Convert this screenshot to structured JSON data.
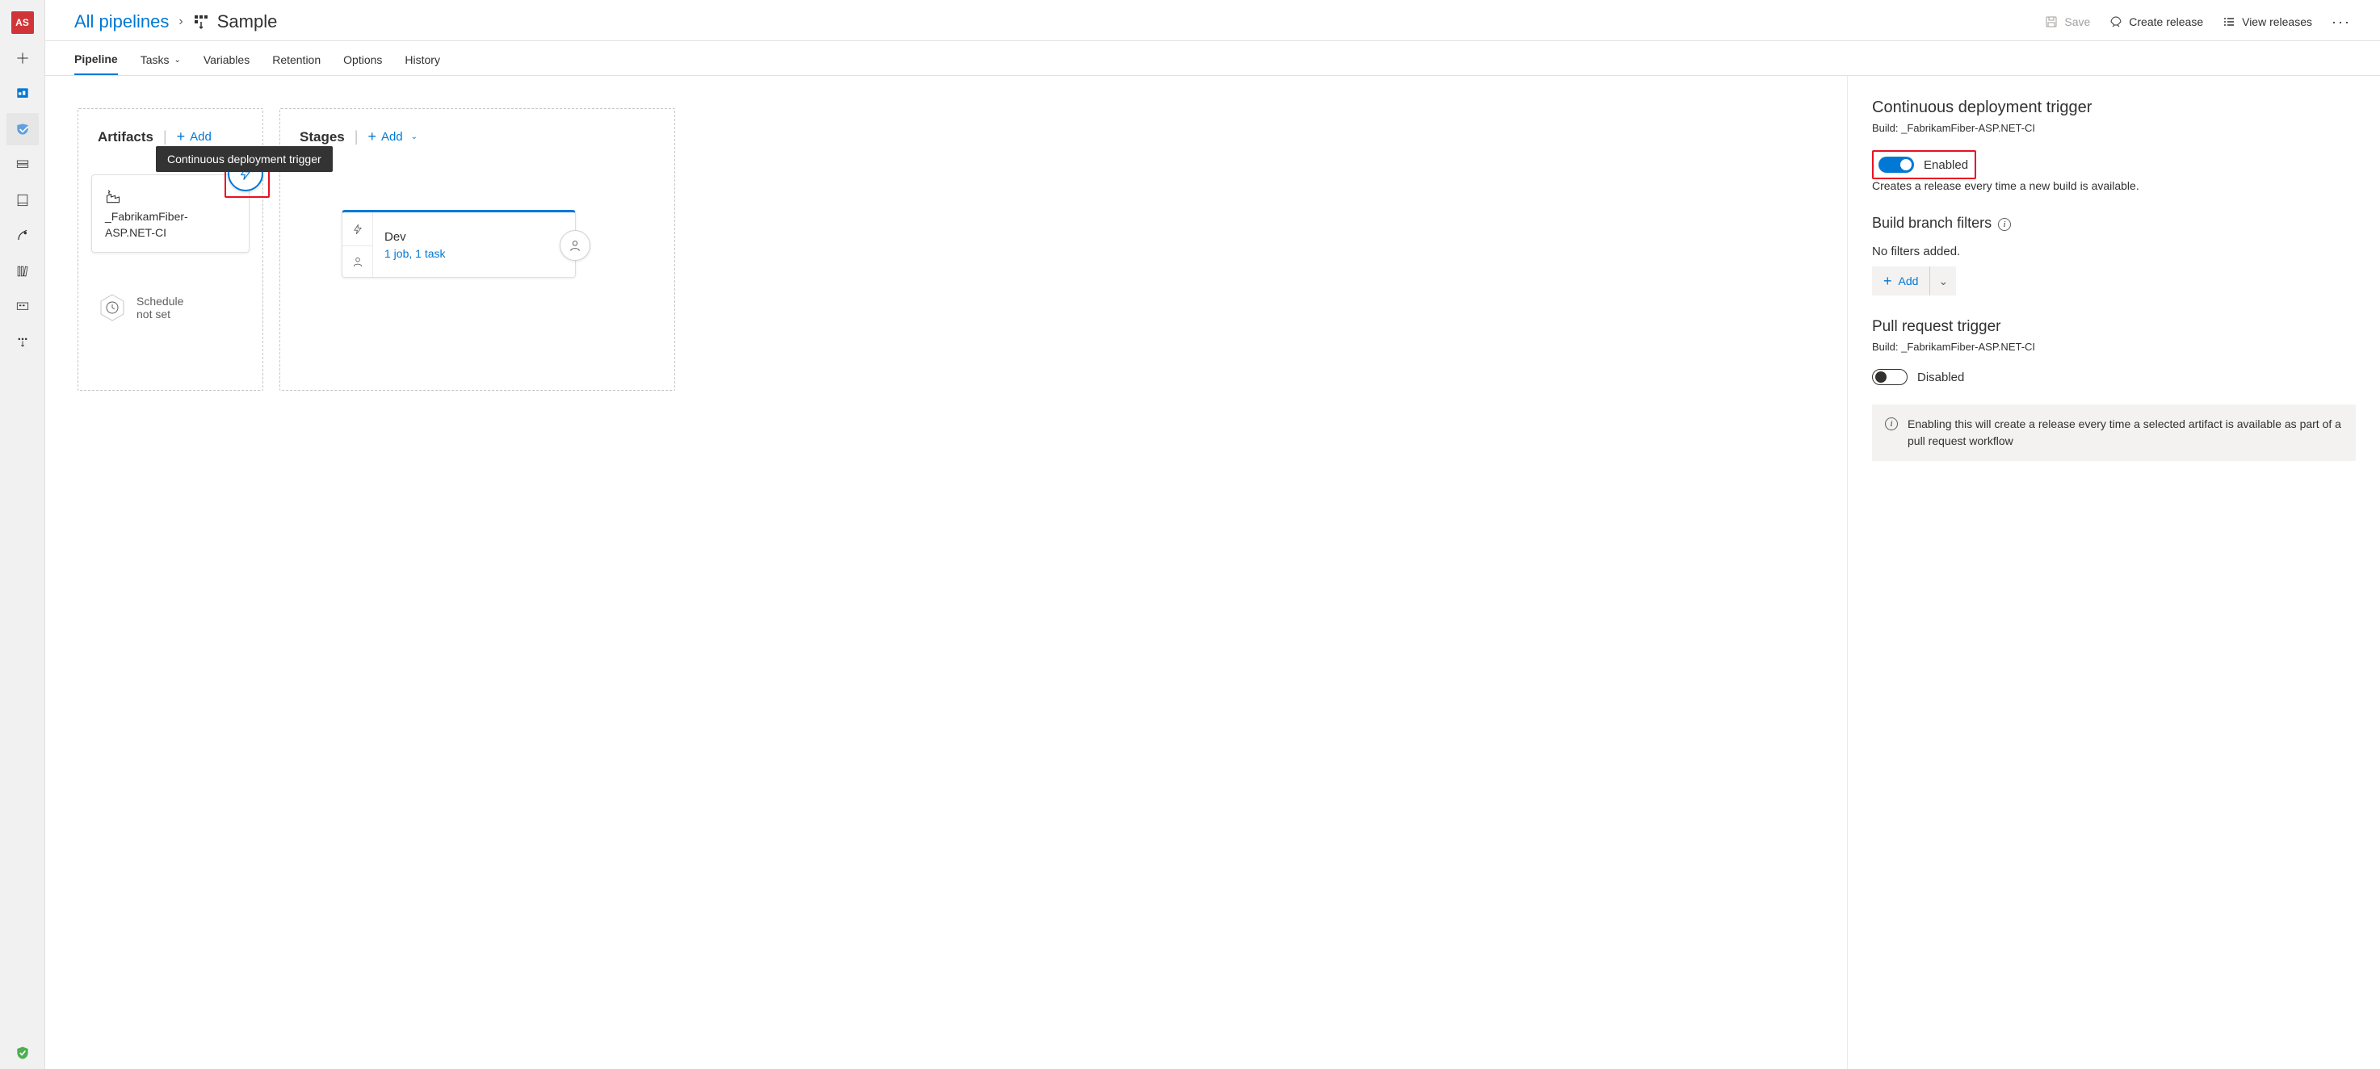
{
  "leftrail": {
    "avatar": "AS"
  },
  "breadcrumb": {
    "all_pipelines": "All pipelines",
    "current": "Sample"
  },
  "header_actions": {
    "save": "Save",
    "create_release": "Create release",
    "view_releases": "View releases"
  },
  "tabs": {
    "pipeline": "Pipeline",
    "tasks": "Tasks",
    "variables": "Variables",
    "retention": "Retention",
    "options": "Options",
    "history": "History"
  },
  "artifacts": {
    "title": "Artifacts",
    "add": "Add",
    "tooltip": "Continuous deployment trigger",
    "card_name": "_FabrikamFiber-ASP.NET-CI",
    "schedule_line1": "Schedule",
    "schedule_line2": "not set"
  },
  "stages": {
    "title": "Stages",
    "add": "Add",
    "stage_name": "Dev",
    "stage_meta": "1 job, 1 task"
  },
  "panel": {
    "cd_title": "Continuous deployment trigger",
    "cd_sub": "Build: _FabrikamFiber-ASP.NET-CI",
    "cd_toggle_label": "Enabled",
    "cd_desc": "Creates a release every time a new build is available.",
    "filters_title": "Build branch filters",
    "no_filters": "No filters added.",
    "add_btn": "Add",
    "pr_title": "Pull request trigger",
    "pr_sub": "Build: _FabrikamFiber-ASP.NET-CI",
    "pr_toggle_label": "Disabled",
    "info": "Enabling this will create a release every time a selected artifact is available as part of a pull request workflow"
  }
}
